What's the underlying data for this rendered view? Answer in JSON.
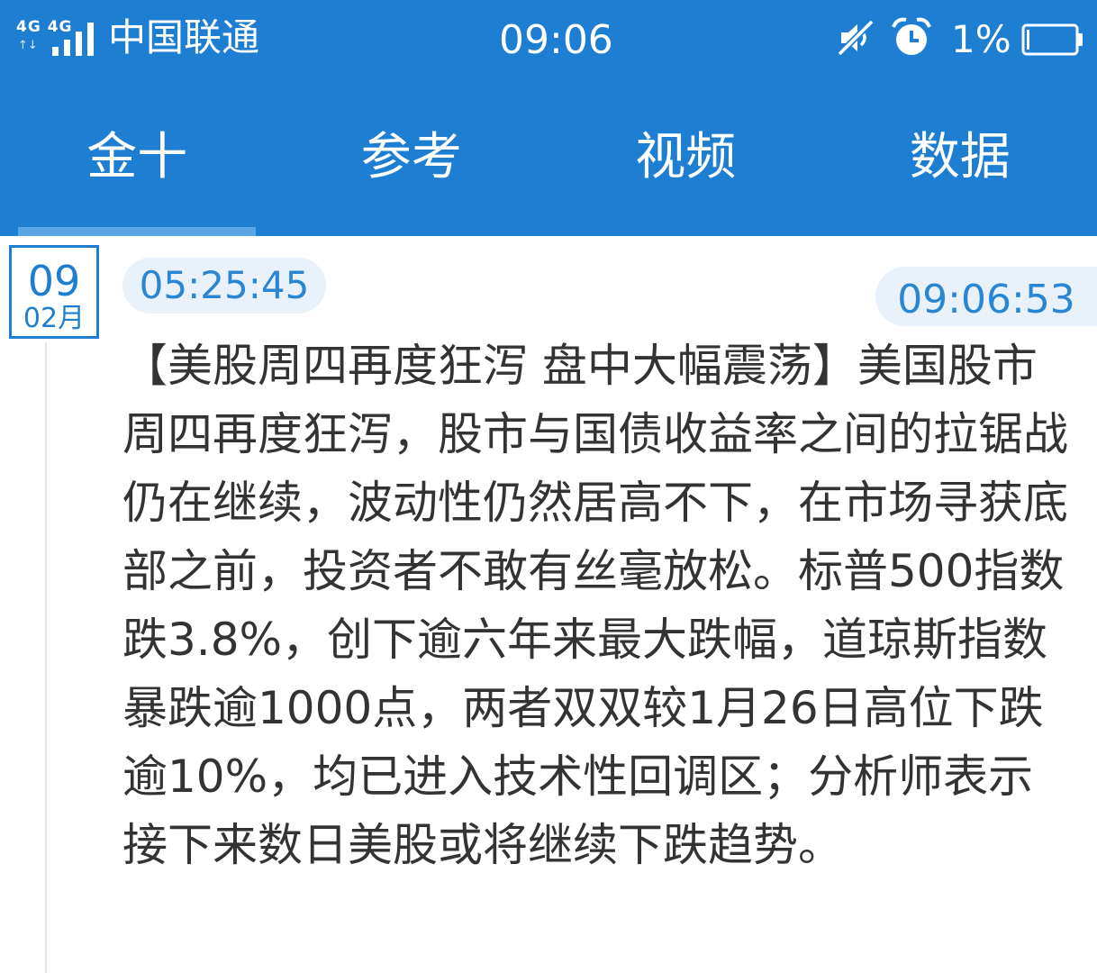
{
  "status_bar": {
    "network_type": "4G 4G",
    "network_arrows": "↑↓",
    "carrier": "中国联通",
    "time": "09:06",
    "battery_percent": "1%",
    "icons": [
      "signal-icon",
      "mute-icon",
      "alarm-icon",
      "battery-icon"
    ]
  },
  "tabs": [
    {
      "label": "金十",
      "active": true
    },
    {
      "label": "参考",
      "active": false
    },
    {
      "label": "视频",
      "active": false
    },
    {
      "label": "数据",
      "active": false
    }
  ],
  "colors": {
    "header_bg": "#1e7fd2",
    "accent": "#2a86d3",
    "pill_bg": "#e9f2fa",
    "text": "#333333"
  },
  "news": {
    "date_day": "09",
    "date_month": "02月",
    "time": "05:25:45",
    "current_time": "09:06:53",
    "content": "【美股周四再度狂泻 盘中大幅震荡】美国股市周四再度狂泻，股市与国债收益率之间的拉锯战仍在继续，波动性仍然居高不下，在市场寻获底部之前，投资者不敢有丝毫放松。标普500指数跌3.8%，创下逾六年来最大跌幅，道琼斯指数暴跌逾1000点，两者双双较1月26日高位下跌逾10%，均已进入技术性回调区；分析师表示接下来数日美股或将继续下跌趋势。"
  }
}
